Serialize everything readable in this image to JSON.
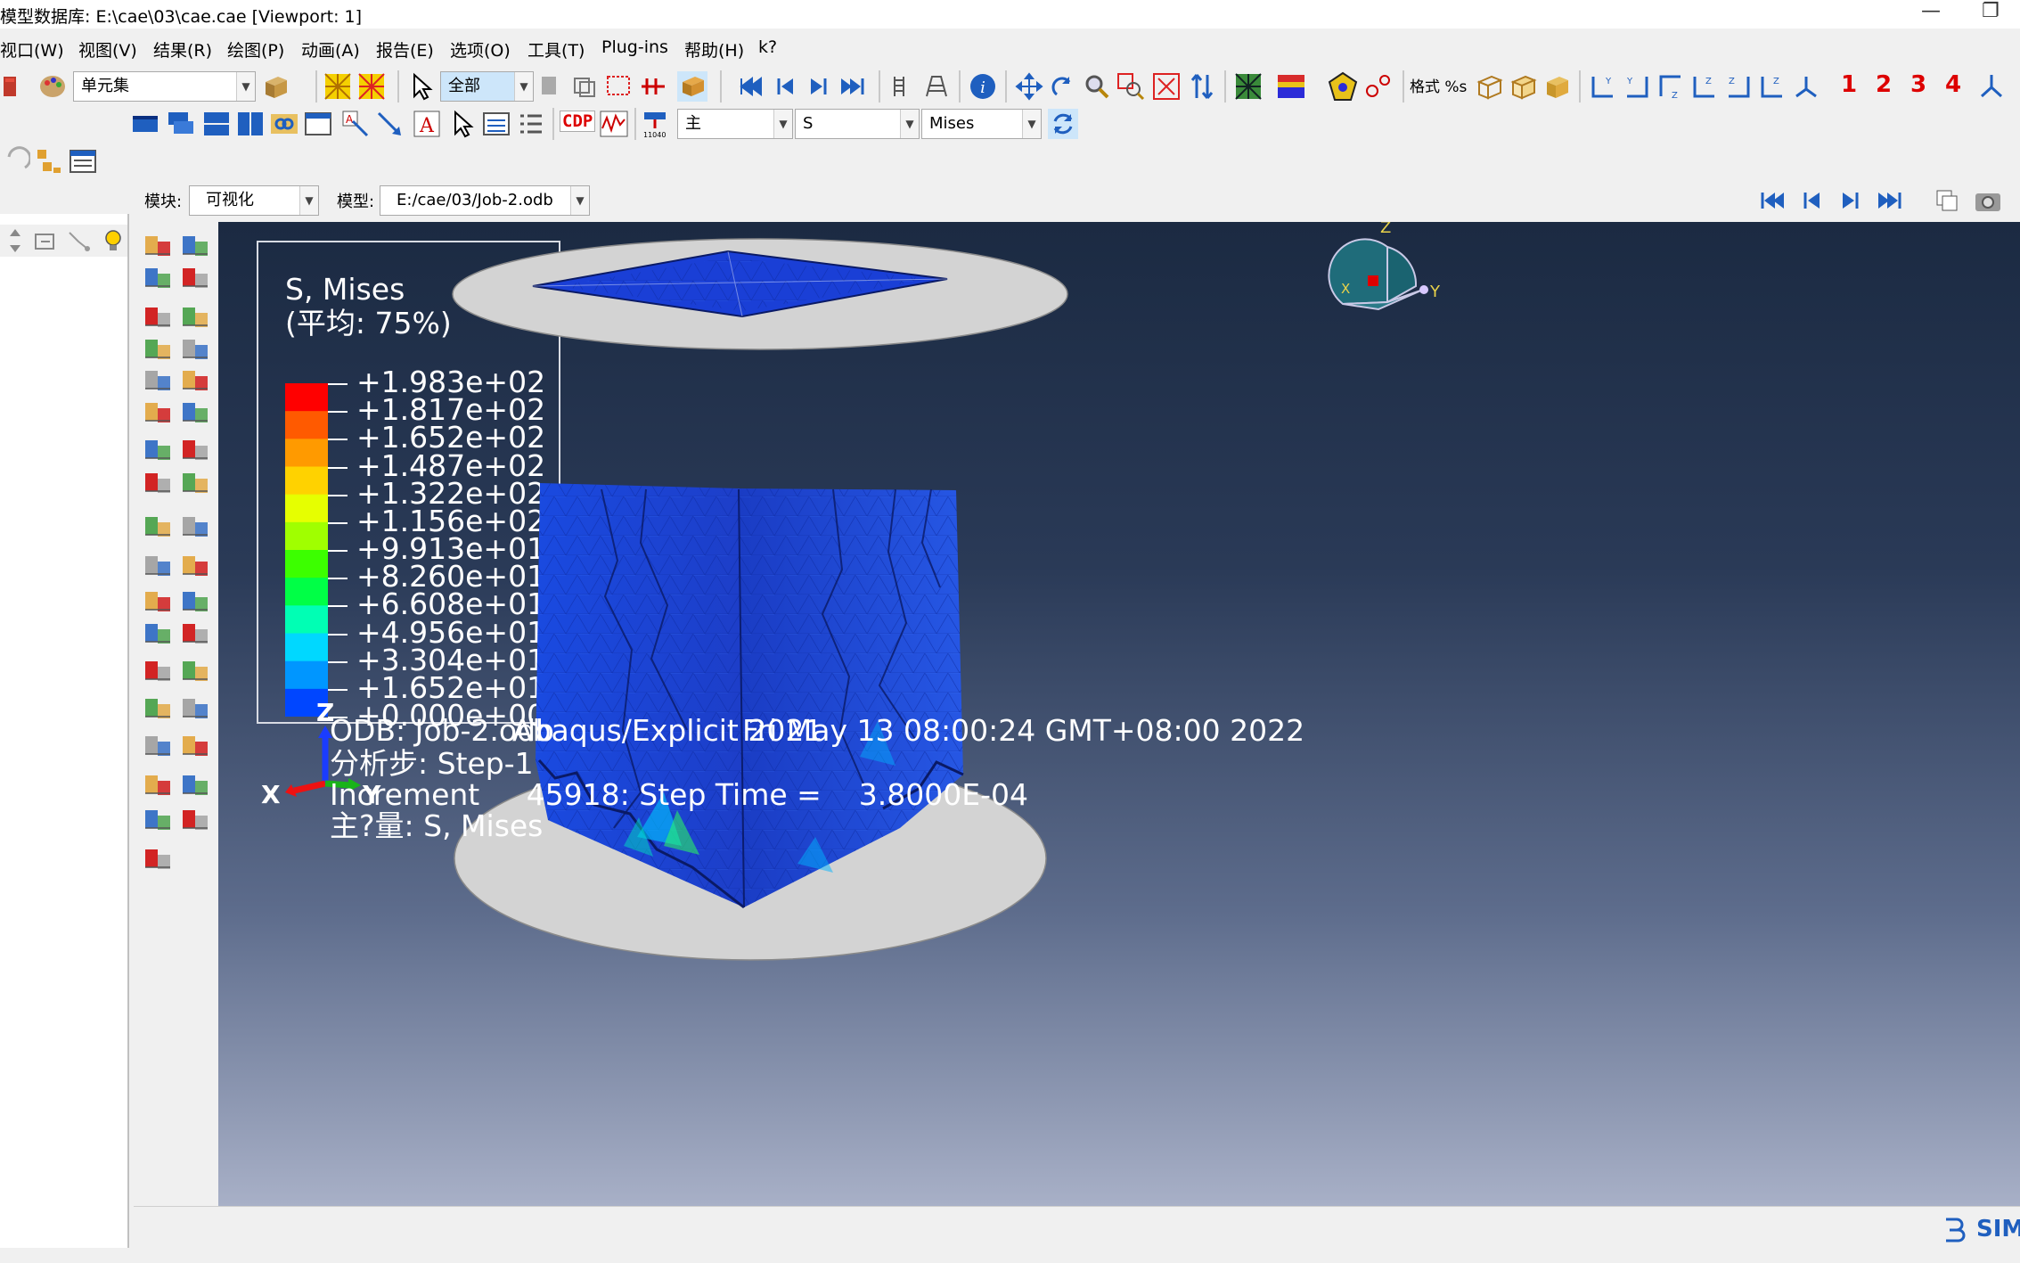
{
  "window": {
    "title": "模型数据库: E:\\cae\\03\\cae.cae [Viewport: 1]",
    "minimize": "—",
    "restore": "❐"
  },
  "menubar": {
    "items": [
      "视口(W)",
      "视图(V)",
      "结果(R)",
      "绘图(P)",
      "动画(A)",
      "报告(E)",
      "选项(O)",
      "工具(T)",
      "Plug-ins",
      "帮助(H)",
      "k?"
    ]
  },
  "toolbar": {
    "element_set_combo": "单元集",
    "selection_combo": "全部",
    "format_label": "格式 %s",
    "view_numbers": [
      "1",
      "2",
      "3",
      "4"
    ],
    "cdp_label": "CDP",
    "field_invariant_combo": "主",
    "field_output_combo": "S",
    "field_component_combo": "Mises"
  },
  "context_bar": {
    "module_label": "模块:",
    "module_value": "可视化",
    "model_label": "模型:",
    "model_value": "E:/cae/03/Job-2.odb"
  },
  "legend": {
    "title_line1": "S, Mises",
    "title_line2": "(平均: 75%)",
    "labels": [
      "+1.983e+02",
      "+1.817e+02",
      "+1.652e+02",
      "+1.487e+02",
      "+1.322e+02",
      "+1.156e+02",
      "+9.913e+01",
      "+8.260e+01",
      "+6.608e+01",
      "+4.956e+01",
      "+3.304e+01",
      "+1.652e+01",
      "+0.000e+00"
    ],
    "colors": [
      "#ff0000",
      "#ff5a00",
      "#ff9a00",
      "#ffd200",
      "#e6ff00",
      "#a0ff00",
      "#3cff00",
      "#00ff46",
      "#00ffb4",
      "#00d8ff",
      "#0096ff",
      "#0046ff",
      "#0000ff"
    ]
  },
  "triad": {
    "z": "Z",
    "x": "X",
    "y": "Y"
  },
  "view_cube": {
    "z": "Z",
    "x": "X",
    "y": "Y"
  },
  "info": {
    "odb": "ODB: Job-2.odb",
    "solver": "Abaqus/Explicit 2021",
    "date": "Fri May 13 08:00:24 GMT+08:00 2022",
    "step": "分析步: Step-1",
    "increment": "Increment     45918: Step Time =    3.8000E-04",
    "primary_var": "主?量: S, Mises"
  },
  "brand": {
    "text": "SIM"
  },
  "colors": {
    "viewport_top": "#1b2a42",
    "viewport_bottom": "#a8b0c7",
    "plate": "#d3d3d3",
    "specimen": "#1a3fd6"
  }
}
